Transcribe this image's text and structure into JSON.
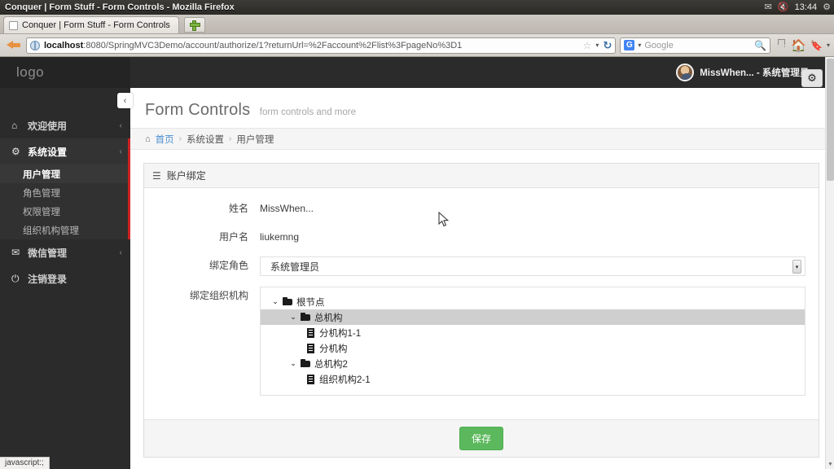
{
  "os": {
    "window_title": "Conquer | Form Stuff - Form Controls - Mozilla Firefox",
    "tray": {
      "mail_icon": "envelope-icon",
      "mail_glyph": "✉",
      "volume_icon": "volume-muted-icon",
      "volume_glyph": "🔇",
      "clock": "13:44",
      "settings_icon": "gear-icon",
      "settings_glyph": "⚙"
    }
  },
  "browser": {
    "tab": {
      "title": "Conquer | Form Stuff - Form Controls",
      "favicon_name": "page-favicon"
    },
    "new_tab_label": "+",
    "back_icon": "back-arrow-icon",
    "url": {
      "host": "localhost",
      "path": ":8080/SpringMVC3Demo/account/authorize/1?returnUrl=%2Faccount%2Flist%3FpageNo%3D1",
      "full": "localhost:8080/SpringMVC3Demo/account/authorize/1?returnUrl=%2Faccount%2Flist%3FpageNo%3D1",
      "identity_icon": "globe-icon",
      "bookmark_icon": "star-icon",
      "reload_icon": "reload-icon",
      "reload_glyph": "↻",
      "dropdown_glyph": "▾"
    },
    "search": {
      "engine": "Google",
      "engine_badge": "G",
      "placeholder": "Google",
      "magnifier_icon": "search-icon",
      "magnifier_glyph": "🔍"
    },
    "toolbar": {
      "downloads_icon": "downloads-icon",
      "home_icon": "home-icon",
      "home_glyph": "🏠",
      "bookmarks_icon": "bookmarks-icon",
      "bookmarks_glyph": "🔖",
      "overflow_glyph": "▾"
    },
    "status_text": "javascript:;"
  },
  "sidebar": {
    "logo": "logo",
    "collapse_toggle": "‹",
    "items": [
      {
        "label": "欢迎使用",
        "icon": "home-icon",
        "glyph": "⌂",
        "caret": "‹",
        "active": false
      },
      {
        "label": "系统设置",
        "icon": "gear-icon",
        "glyph": "⚙",
        "caret": "‹",
        "active": true
      },
      {
        "label": "微信管理",
        "icon": "chat-icon",
        "glyph": "✉",
        "caret": "‹",
        "active": false
      },
      {
        "label": "注销登录",
        "icon": "power-icon",
        "glyph": "⏻",
        "caret": "",
        "active": false
      }
    ],
    "submenu": [
      {
        "label": "用户管理",
        "selected": true
      },
      {
        "label": "角色管理",
        "selected": false
      },
      {
        "label": "权限管理",
        "selected": false
      },
      {
        "label": "组织机构管理",
        "selected": false
      }
    ]
  },
  "topbar": {
    "user_name": "MissWhen... - 系统管理员",
    "avatar_icon": "avatar",
    "caret": "⌄"
  },
  "page": {
    "title": "Form Controls",
    "subtitle": "form controls and more",
    "settings_icon": "gear-icon",
    "settings_glyph": "⚙",
    "breadcrumb": {
      "home_icon": "home-icon",
      "home_glyph": "⌂",
      "items": [
        {
          "label": "首页",
          "link": true
        },
        {
          "label": "系统设置",
          "link": false
        },
        {
          "label": "用户管理",
          "link": false
        }
      ],
      "separator": "›"
    }
  },
  "panel": {
    "header_icon": "list-icon",
    "header_glyph": "☰",
    "header_title": "账户绑定",
    "fields": {
      "name_label": "姓名",
      "name_value": "MissWhen...",
      "username_label": "用户名",
      "username_value": "liukemng",
      "role_label": "绑定角色",
      "role_value": "系统管理员",
      "org_label": "绑定组织机构"
    },
    "tree": [
      {
        "label": "根节点",
        "level": 1,
        "type": "folder",
        "expanded": true,
        "highlight": false
      },
      {
        "label": "总机构",
        "level": 2,
        "type": "folder",
        "expanded": true,
        "highlight": true
      },
      {
        "label": "分机构1-1",
        "level": 3,
        "type": "file",
        "expanded": false,
        "highlight": false
      },
      {
        "label": "分机构",
        "level": 3,
        "type": "file",
        "expanded": false,
        "highlight": false
      },
      {
        "label": "总机构2",
        "level": 2,
        "type": "folder",
        "expanded": true,
        "highlight": false
      },
      {
        "label": "组织机构2-1",
        "level": 3,
        "type": "file",
        "expanded": false,
        "highlight": false
      }
    ],
    "expand_glyph": "⌄",
    "save_label": "保存"
  },
  "colors": {
    "sidebar_bg": "#2b2b2b",
    "accent_red": "#cc2222",
    "save_green": "#5cb85c",
    "link_blue": "#4c8fd0"
  }
}
